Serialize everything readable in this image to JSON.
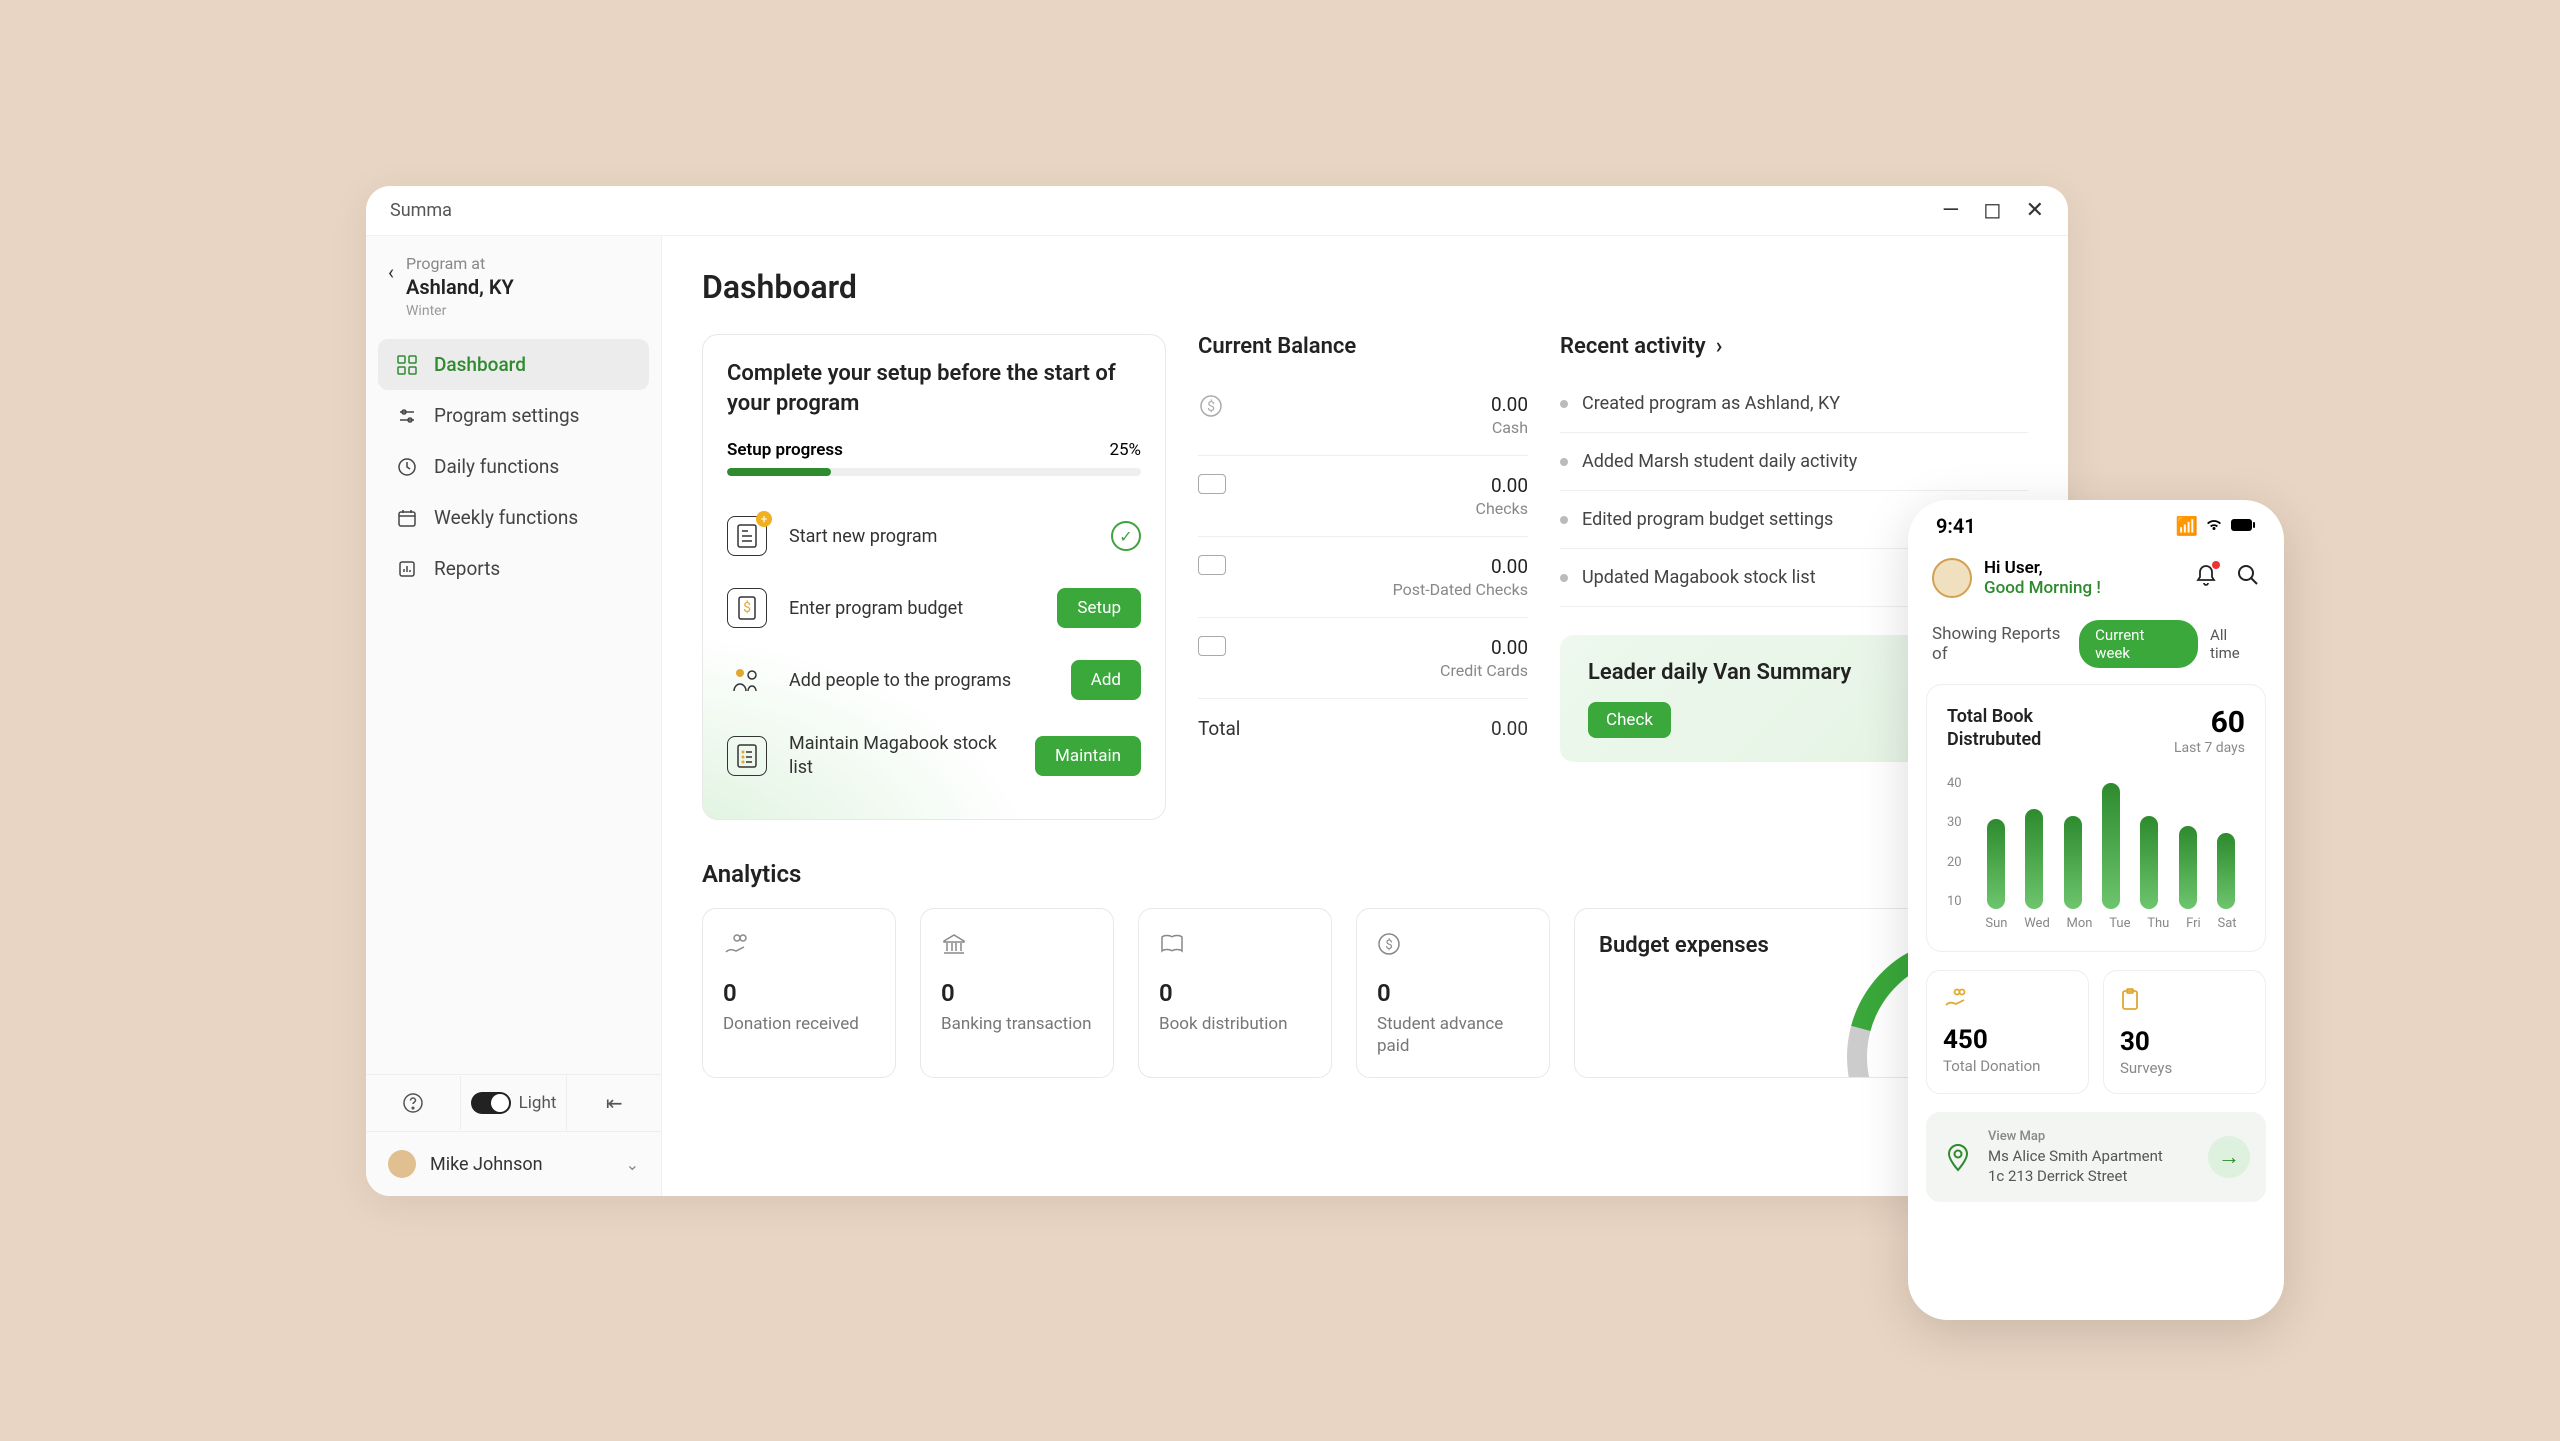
{
  "app_name": "Summa",
  "sidebar": {
    "back": {
      "program_at": "Program at",
      "location": "Ashland, KY",
      "season": "Winter"
    },
    "nav": [
      {
        "label": "Dashboard",
        "active": true
      },
      {
        "label": "Program settings"
      },
      {
        "label": "Daily functions"
      },
      {
        "label": "Weekly functions"
      },
      {
        "label": "Reports"
      }
    ],
    "theme_label": "Light",
    "user_name": "Mike Johnson"
  },
  "page_title": "Dashboard",
  "setup": {
    "title": "Complete your setup before the start of your program",
    "progress_label": "Setup progress",
    "progress_pct": "25%",
    "progress_val": 25,
    "tasks": [
      {
        "label": "Start new program",
        "done": true
      },
      {
        "label": "Enter program budget",
        "btn": "Setup"
      },
      {
        "label": "Add people to the programs",
        "btn": "Add"
      },
      {
        "label": "Maintain Magabook stock list",
        "btn": "Maintain"
      }
    ]
  },
  "balance": {
    "title": "Current Balance",
    "rows": [
      {
        "amt": "0.00",
        "lbl": "Cash"
      },
      {
        "amt": "0.00",
        "lbl": "Checks"
      },
      {
        "amt": "0.00",
        "lbl": "Post-Dated Checks"
      },
      {
        "amt": "0.00",
        "lbl": "Credit Cards"
      }
    ],
    "total_lbl": "Total",
    "total_amt": "0.00"
  },
  "activity": {
    "title": "Recent activity",
    "items": [
      "Created program as Ashland, KY",
      "Added Marsh student daily activity",
      "Edited program budget settings",
      "Updated Magabook stock list"
    ]
  },
  "leader": {
    "title": "Leader daily Van Summary",
    "btn": "Check"
  },
  "analytics": {
    "title": "Analytics",
    "cards": [
      {
        "val": "0",
        "lbl": "Donation received"
      },
      {
        "val": "0",
        "lbl": "Banking transaction"
      },
      {
        "val": "0",
        "lbl": "Book distribution"
      },
      {
        "val": "0",
        "lbl": "Student advance paid"
      }
    ]
  },
  "budget": {
    "title": "Budget expenses"
  },
  "mobile": {
    "time": "9:41",
    "greet": "Hi User,",
    "morning": "Good Morning !",
    "reports_of": "Showing Reports of",
    "pill": "Current week",
    "pill_alt": "All time",
    "chart": {
      "label": "Total Book Distrubuted",
      "big_val": "60",
      "big_sub": "Last 7 days"
    },
    "stats": [
      {
        "val": "450",
        "lbl": "Total Donation"
      },
      {
        "val": "30",
        "lbl": "Surveys"
      }
    ],
    "map": {
      "title": "View Map",
      "line1": "Ms Alice Smith Apartment",
      "line2": "1c 213 Derrick Street"
    }
  },
  "chart_data": {
    "type": "bar",
    "categories": [
      "Sun",
      "Wed",
      "Mon",
      "Tue",
      "Thu",
      "Fri",
      "Sat"
    ],
    "values": [
      27,
      30,
      28,
      38,
      28,
      25,
      23
    ],
    "title": "Total Book Distrubuted",
    "xlabel": "",
    "ylabel": "",
    "ylim": [
      0,
      40
    ],
    "y_ticks": [
      40,
      30,
      20,
      10
    ]
  }
}
